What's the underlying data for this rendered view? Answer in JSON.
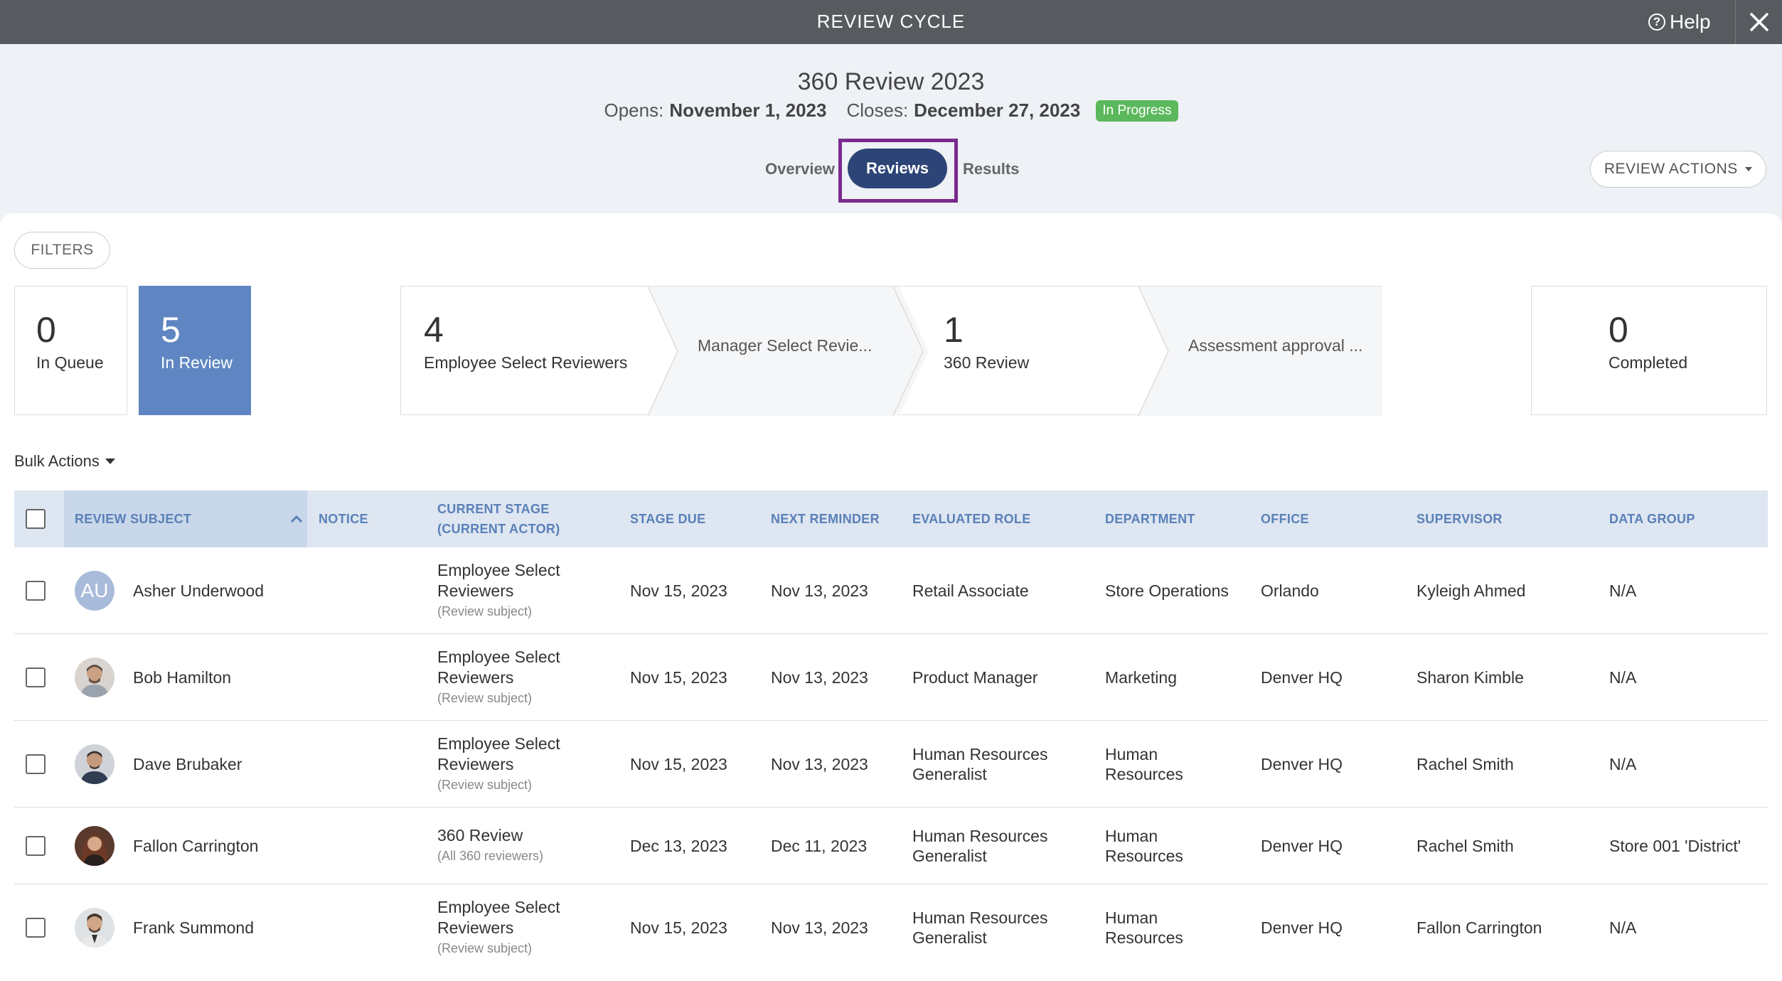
{
  "topbar": {
    "title": "REVIEW CYCLE",
    "help_label": "Help",
    "help_icon": "question-circle-icon",
    "close_icon": "close-icon"
  },
  "cycle": {
    "title": "360 Review 2023",
    "opens_label": "Opens:",
    "opens_date": "November 1, 2023",
    "closes_label": "Closes:",
    "closes_date": "December 27, 2023",
    "status": "In Progress"
  },
  "tabs": {
    "overview": "Overview",
    "reviews": "Reviews",
    "results": "Results",
    "active": "Reviews"
  },
  "review_actions_label": "REVIEW ACTIONS",
  "filters_label": "FILTERS",
  "stats": {
    "queue": {
      "count": "0",
      "label": "In Queue"
    },
    "review": {
      "count": "5",
      "label": "In Review"
    },
    "completed": {
      "count": "0",
      "label": "Completed"
    }
  },
  "pipeline": [
    {
      "count": "4",
      "label": "Employee Select Reviewers"
    },
    {
      "count": "",
      "label": "Manager Select Revie..."
    },
    {
      "count": "1",
      "label": "360 Review"
    },
    {
      "count": "",
      "label": "Assessment approval ..."
    }
  ],
  "bulk_actions_label": "Bulk Actions",
  "table": {
    "columns": {
      "subject": "REVIEW SUBJECT",
      "notice": "NOTICE",
      "stage_line1": "CURRENT STAGE",
      "stage_line2": "(CURRENT ACTOR)",
      "stage_due": "STAGE DUE",
      "next_reminder": "NEXT REMINDER",
      "role": "EVALUATED ROLE",
      "department": "DEPARTMENT",
      "office": "OFFICE",
      "supervisor": "SUPERVISOR",
      "data_group": "DATA GROUP"
    },
    "rows": [
      {
        "initials": "AU",
        "name": "Asher Underwood",
        "stage_l1": "Employee Select",
        "stage_l2": "Reviewers",
        "actor": "(Review subject)",
        "due": "Nov 15, 2023",
        "reminder": "Nov 13, 2023",
        "role_l1": "Retail Associate",
        "role_l2": "",
        "dept_l1": "Store Operations",
        "dept_l2": "",
        "office": "Orlando",
        "supervisor": "Kyleigh Ahmed",
        "data_group": "N/A"
      },
      {
        "initials": "",
        "name": "Bob Hamilton",
        "stage_l1": "Employee Select",
        "stage_l2": "Reviewers",
        "actor": "(Review subject)",
        "due": "Nov 15, 2023",
        "reminder": "Nov 13, 2023",
        "role_l1": "Product Manager",
        "role_l2": "",
        "dept_l1": "Marketing",
        "dept_l2": "",
        "office": "Denver HQ",
        "supervisor": "Sharon Kimble",
        "data_group": "N/A"
      },
      {
        "initials": "",
        "name": "Dave Brubaker",
        "stage_l1": "Employee Select",
        "stage_l2": "Reviewers",
        "actor": "(Review subject)",
        "due": "Nov 15, 2023",
        "reminder": "Nov 13, 2023",
        "role_l1": "Human Resources",
        "role_l2": "Generalist",
        "dept_l1": "Human",
        "dept_l2": "Resources",
        "office": "Denver HQ",
        "supervisor": "Rachel Smith",
        "data_group": "N/A"
      },
      {
        "initials": "",
        "name": "Fallon Carrington",
        "stage_l1": "360 Review",
        "stage_l2": "",
        "actor": "(All 360 reviewers)",
        "due": "Dec 13, 2023",
        "reminder": "Dec 11, 2023",
        "role_l1": "Human Resources",
        "role_l2": "Generalist",
        "dept_l1": "Human",
        "dept_l2": "Resources",
        "office": "Denver HQ",
        "supervisor": "Rachel Smith",
        "data_group": "Store 001 'District'"
      },
      {
        "initials": "",
        "name": "Frank Summond",
        "stage_l1": "Employee Select",
        "stage_l2": "Reviewers",
        "actor": "(Review subject)",
        "due": "Nov 15, 2023",
        "reminder": "Nov 13, 2023",
        "role_l1": "Human Resources",
        "role_l2": "Generalist",
        "dept_l1": "Human",
        "dept_l2": "Resources",
        "office": "Denver HQ",
        "supervisor": "Fallon Carrington",
        "data_group": "N/A"
      }
    ]
  },
  "colors": {
    "topbar": "#575b60",
    "accent": "#2c4476",
    "active_stat": "#5f86c2",
    "status_green": "#5cb85c",
    "highlight_frame": "#7a2a8e",
    "header_text": "#5a80b8"
  }
}
